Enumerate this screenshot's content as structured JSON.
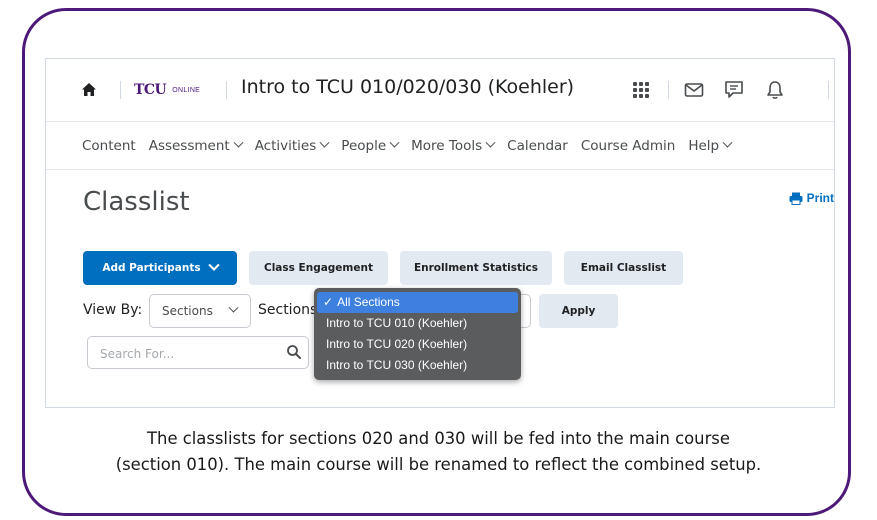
{
  "header": {
    "logo_main": "TCU",
    "logo_sub": "ONLINE",
    "course_title": "Intro to TCU 010/020/030 (Koehler)"
  },
  "nav": {
    "items": [
      {
        "label": "Content"
      },
      {
        "label": "Assessment"
      },
      {
        "label": "Activities"
      },
      {
        "label": "People"
      },
      {
        "label": "More Tools"
      },
      {
        "label": "Calendar"
      },
      {
        "label": "Course Admin"
      },
      {
        "label": "Help"
      }
    ]
  },
  "page": {
    "title": "Classlist",
    "print_label": "Print"
  },
  "actions": {
    "add_participants": "Add Participants",
    "class_engagement": "Class Engagement",
    "enrollment_statistics": "Enrollment Statistics",
    "email_classlist": "Email Classlist"
  },
  "filters": {
    "view_by_label": "View By:",
    "view_by_value": "Sections",
    "sections_label": "Sections",
    "apply_label": "Apply",
    "search_placeholder": "Search For..."
  },
  "dropdown": {
    "options": [
      {
        "label": "All Sections",
        "selected": true
      },
      {
        "label": "Intro to TCU 010 (Koehler)"
      },
      {
        "label": "Intro to TCU 020 (Koehler)"
      },
      {
        "label": "Intro to TCU 030 (Koehler)"
      }
    ]
  },
  "caption": {
    "line1": "The classlists for sections 020 and 030 will be fed into the main course",
    "line2": "(section 010). The main course will be renamed to reflect the combined setup."
  },
  "colors": {
    "frame": "#4d1979",
    "primary": "#006fbf",
    "dropdown_bg": "#5a5c5e",
    "dropdown_selected": "#3d80de"
  }
}
